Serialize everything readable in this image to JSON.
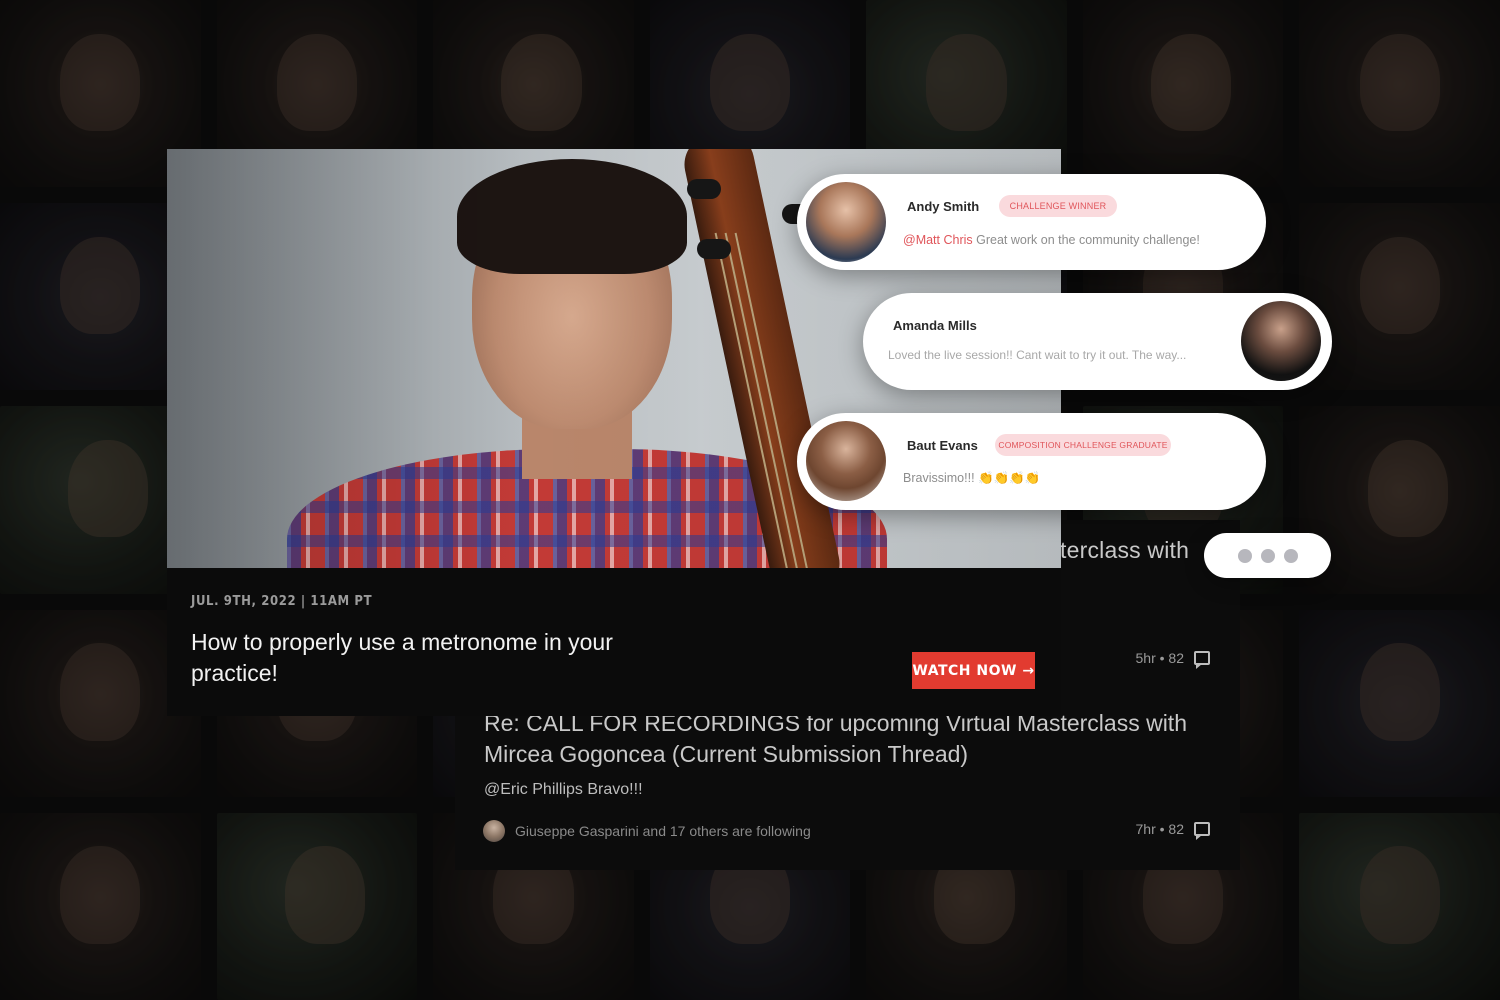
{
  "video": {
    "date": "JUL. 9TH, 2022 | 11AM PT",
    "title": "How to properly use a metronome in your practice!",
    "watch_label": "WATCH NOW →"
  },
  "forum": {
    "partial_title": "terclass with",
    "first_meta": "5hr • 82",
    "title": "Re: CALL FOR RECORDINGS for upcoming Virtual Masterclass with Mircea Gogoncea (Current Submission Thread)",
    "reply": "@Eric Phillips Bravo!!!",
    "following": "Giuseppe Gasparini and 17 others are following",
    "second_meta": "7hr • 82"
  },
  "comments": [
    {
      "name": "Andy Smith",
      "badge": "Challenge Winner",
      "mention": "@Matt Chris",
      "message": "Great work on the community challenge!"
    },
    {
      "name": "Amanda Mills",
      "message": "Loved the live session!! Cant wait to try it out. The way..."
    },
    {
      "name": "Baut Evans",
      "badge": "Composition Challenge Graduate",
      "message": "Bravissimo!!! 👏👏👏👏"
    }
  ],
  "icons": [
    "comment-icon",
    "typing-indicator"
  ]
}
